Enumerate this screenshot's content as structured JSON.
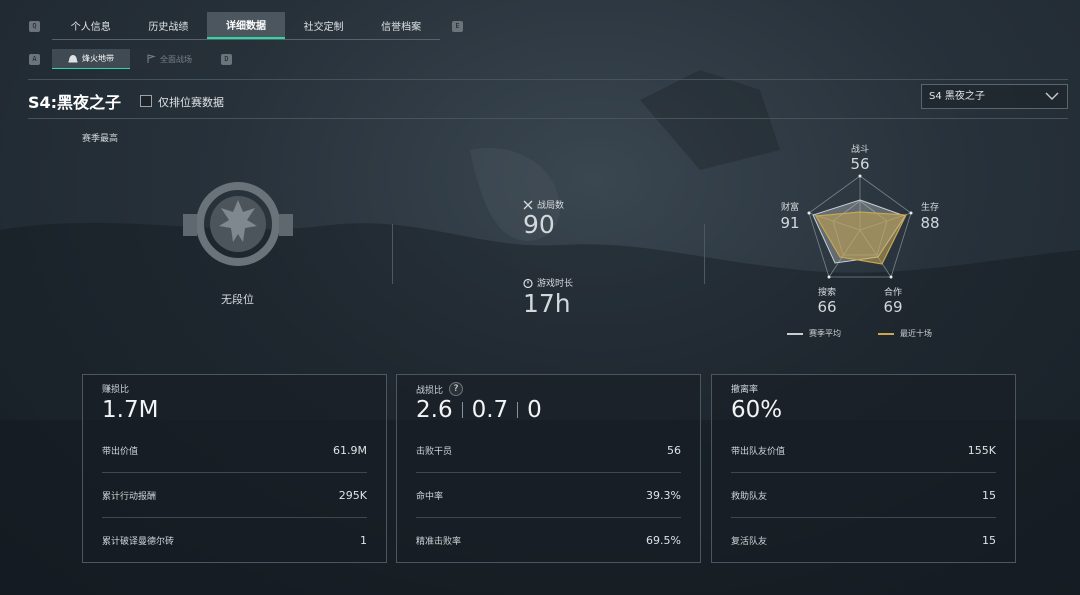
{
  "keyhints": {
    "tabs_left": "Q",
    "tabs_right": "E",
    "sub_left": "A",
    "sub_right": "D"
  },
  "tabs": [
    {
      "label": "个人信息"
    },
    {
      "label": "历史战绩"
    },
    {
      "label": "详细数据"
    },
    {
      "label": "社交定制"
    },
    {
      "label": "信誉档案"
    }
  ],
  "subtabs": [
    {
      "label": "烽火地带"
    },
    {
      "label": "全面战场"
    }
  ],
  "season": {
    "title": "S4:黑夜之子",
    "ranked_only_label": "仅排位赛数据",
    "dropdown_value": "S4 黑夜之子"
  },
  "season_best": {
    "label": "赛季最高",
    "rank": "无段位"
  },
  "stats": {
    "matches_label": "战局数",
    "matches_value": "90",
    "playtime_label": "游戏时长",
    "playtime_value": "17h"
  },
  "radar": {
    "combat": {
      "label": "战斗",
      "value": "56"
    },
    "survival": {
      "label": "生存",
      "value": "88"
    },
    "teamwork": {
      "label": "合作",
      "value": "69"
    },
    "search": {
      "label": "搜索",
      "value": "66"
    },
    "wealth": {
      "label": "财富",
      "value": "91"
    },
    "legend_avg": "赛季平均",
    "legend_recent": "最近十场",
    "colors": {
      "avg": "#c8ced2",
      "recent": "#c9a650"
    }
  },
  "cards": [
    {
      "label": "赚损比",
      "value": "1.7M",
      "rows": [
        {
          "label": "带出价值",
          "value": "61.9M"
        },
        {
          "label": "累计行动报酬",
          "value": "295K"
        },
        {
          "label": "累计破译曼德尔砖",
          "value": "1"
        }
      ]
    },
    {
      "label": "战损比",
      "values": [
        "2.6",
        "0.7",
        "0"
      ],
      "rows": [
        {
          "label": "击败干员",
          "value": "56"
        },
        {
          "label": "命中率",
          "value": "39.3%"
        },
        {
          "label": "精准击败率",
          "value": "69.5%"
        }
      ]
    },
    {
      "label": "撤离率",
      "value": "60%",
      "rows": [
        {
          "label": "带出队友价值",
          "value": "155K"
        },
        {
          "label": "救助队友",
          "value": "15"
        },
        {
          "label": "复活队友",
          "value": "15"
        }
      ]
    }
  ],
  "help_glyph": "?",
  "accent": "#2fd8a2"
}
